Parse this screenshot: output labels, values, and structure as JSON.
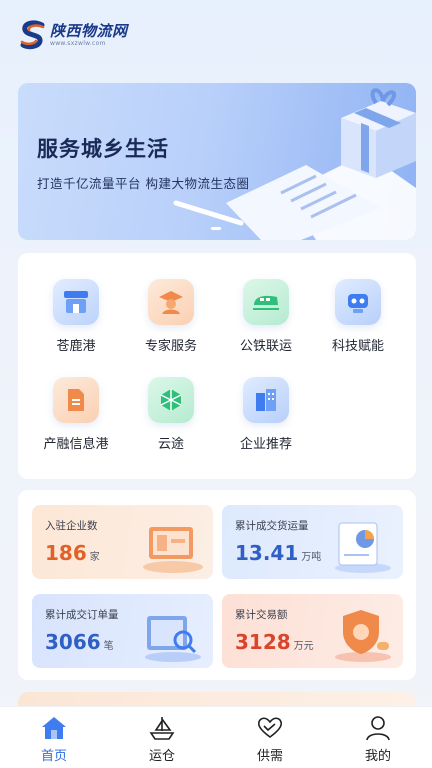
{
  "header": {
    "logo_text": "陕西物流网",
    "logo_sub": "www.sxzwlw.com"
  },
  "banner": {
    "title": "服务城乡生活",
    "subtitle": "打造千亿流量平台 构建大物流生态圈"
  },
  "services": [
    {
      "label": "苍鹿港",
      "icon": "store-icon"
    },
    {
      "label": "专家服务",
      "icon": "expert-icon"
    },
    {
      "label": "公铁联运",
      "icon": "train-icon"
    },
    {
      "label": "科技赋能",
      "icon": "robot-icon"
    },
    {
      "label": "产融信息港",
      "icon": "document-icon"
    },
    {
      "label": "云途",
      "icon": "cube-network-icon"
    },
    {
      "label": "企业推荐",
      "icon": "building-icon"
    }
  ],
  "stats": [
    {
      "label": "入驻企业数",
      "value": "186",
      "unit": "家",
      "color": "#e0622a"
    },
    {
      "label": "累计成交货运量",
      "value": "13.41",
      "unit": "万吨",
      "color": "#2f5fc4"
    },
    {
      "label": "累计成交订单量",
      "value": "3066",
      "unit": "笔",
      "color": "#2f5fc4"
    },
    {
      "label": "累计交易额",
      "value": "3128",
      "unit": "万元",
      "color": "#d8452c"
    }
  ],
  "tabs": [
    {
      "label": "首页",
      "icon": "home-icon",
      "active": true
    },
    {
      "label": "运仓",
      "icon": "ship-icon",
      "active": false
    },
    {
      "label": "供需",
      "icon": "handshake-icon",
      "active": false
    },
    {
      "label": "我的",
      "icon": "user-icon",
      "active": false
    }
  ],
  "colors": {
    "accent": "#2f6de0",
    "brand": "#1a3a8a"
  }
}
